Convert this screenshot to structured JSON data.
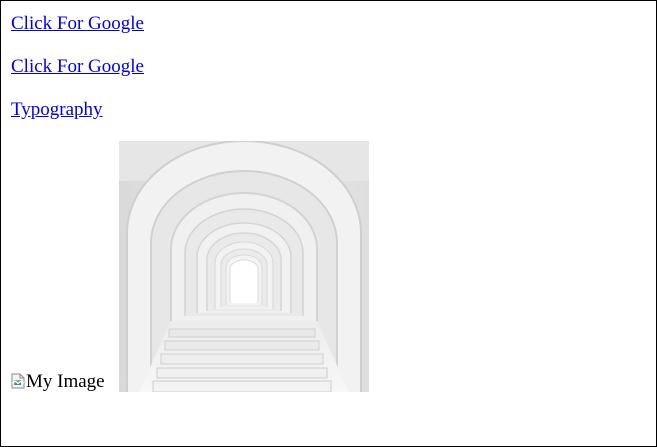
{
  "links": [
    {
      "label": "Click For Google"
    },
    {
      "label": "Click For Google"
    },
    {
      "label": "Typography"
    }
  ],
  "broken_image": {
    "alt": "My Image",
    "icon": "broken-image-icon"
  },
  "photo": {
    "subject": "arch-corridor-photo"
  }
}
